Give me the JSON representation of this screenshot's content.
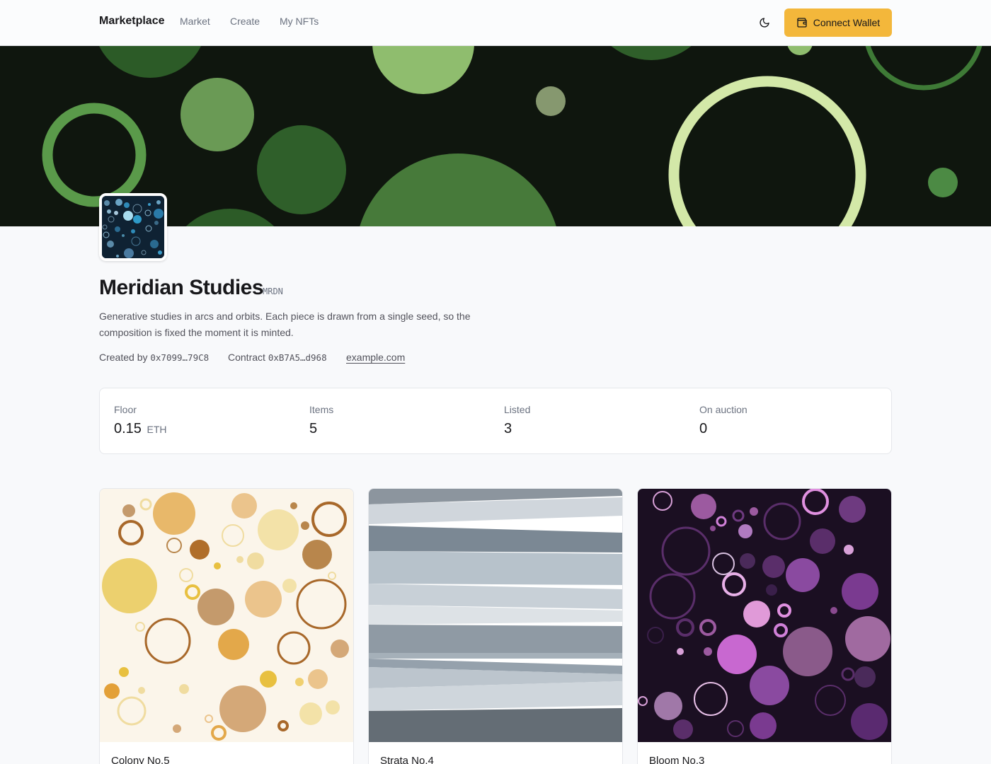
{
  "nav": {
    "brand": "Marketplace",
    "links": [
      "Market",
      "Create",
      "My NFTs"
    ],
    "connect_wallet": "Connect Wallet"
  },
  "collection": {
    "name": "Meridian Studies",
    "symbol": "MRDN",
    "description": "Generative studies in arcs and orbits. Each piece is drawn from a single seed, so the composition is fixed the moment it is minted.",
    "created_by_label": "Created by",
    "creator_address": "0x7099…79C8",
    "contract_label": "Contract",
    "contract_address": "0xB7A5…d968",
    "website": "example.com"
  },
  "stats": [
    {
      "label": "Floor",
      "value": "0.15",
      "unit": "ETH"
    },
    {
      "label": "Items",
      "value": "5",
      "unit": ""
    },
    {
      "label": "Listed",
      "value": "3",
      "unit": ""
    },
    {
      "label": "On auction",
      "value": "0",
      "unit": ""
    }
  ],
  "items": [
    {
      "title": "Colony No.5"
    },
    {
      "title": "Strata No.4"
    },
    {
      "title": "Bloom No.3"
    }
  ],
  "colors": {
    "accent": "#f3b73b",
    "banner_bg": "#0f160e",
    "avatar_bg": "#0f2233",
    "colony_bg": "#fbf5ea",
    "bloom_bg": "#1b0f22"
  },
  "icons": {
    "theme": "moon-icon",
    "wallet": "wallet-icon"
  }
}
